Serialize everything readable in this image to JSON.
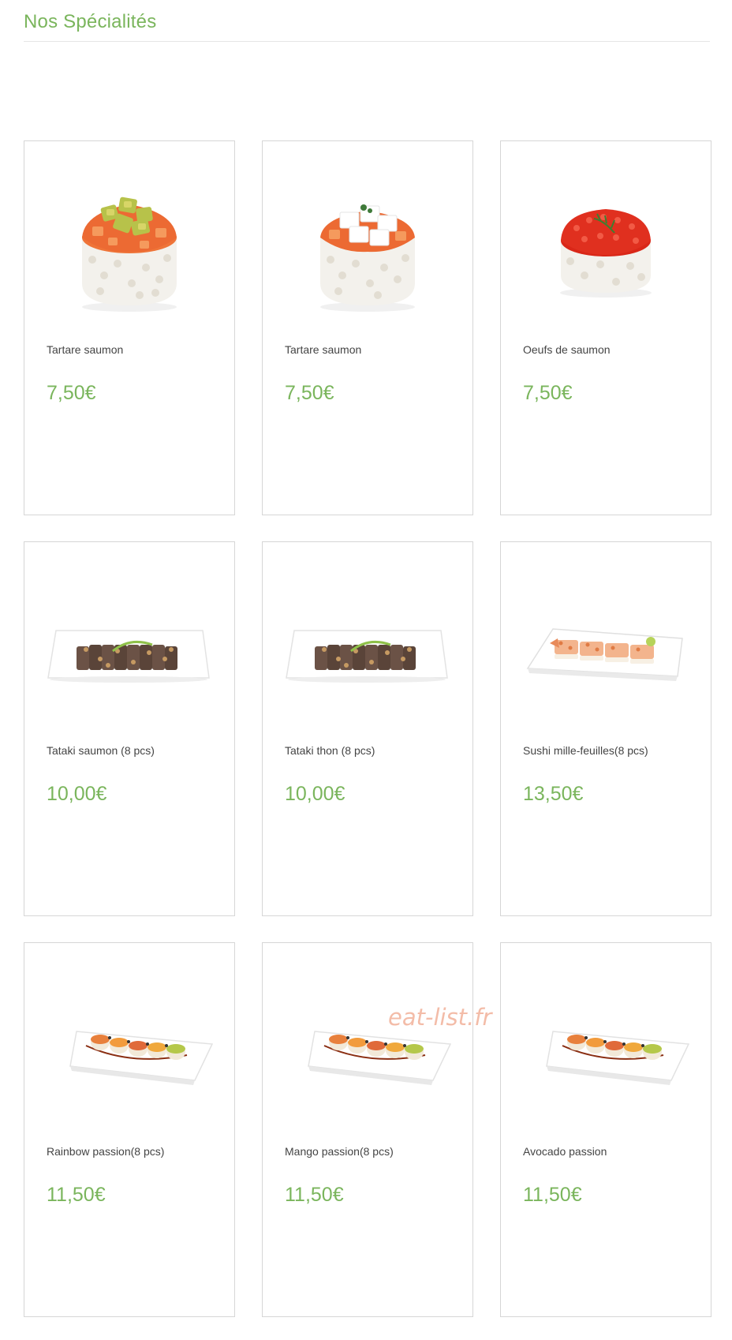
{
  "section": {
    "title": "Nos Spécialités"
  },
  "products": [
    {
      "name": "Tartare saumon",
      "price": "7,50€",
      "image_icon": "tartare-avocado-image"
    },
    {
      "name": "Tartare saumon",
      "price": "7,50€",
      "image_icon": "tartare-cheese-image"
    },
    {
      "name": "Oeufs de saumon",
      "price": "7,50€",
      "image_icon": "salmon-roe-image"
    },
    {
      "name": "Tataki saumon (8 pcs)",
      "price": "10,00€",
      "image_icon": "tataki-plate-image"
    },
    {
      "name": "Tataki thon (8 pcs)",
      "price": "10,00€",
      "image_icon": "tataki-plate-image"
    },
    {
      "name": "Sushi mille-feuilles(8 pcs)",
      "price": "13,50€",
      "image_icon": "millefeuille-plate-image"
    },
    {
      "name": "Rainbow passion(8 pcs)",
      "price": "11,50€",
      "image_icon": "roll-plate-image"
    },
    {
      "name": "Mango passion(8 pcs)",
      "price": "11,50€",
      "image_icon": "roll-plate-image"
    },
    {
      "name": "Avocado passion",
      "price": "11,50€",
      "image_icon": "roll-plate-image"
    }
  ],
  "watermark": "eat-list.fr",
  "colors": {
    "accent": "#7ab55c",
    "card_border": "#d6d6d6",
    "watermark": "#f3b9a4"
  }
}
